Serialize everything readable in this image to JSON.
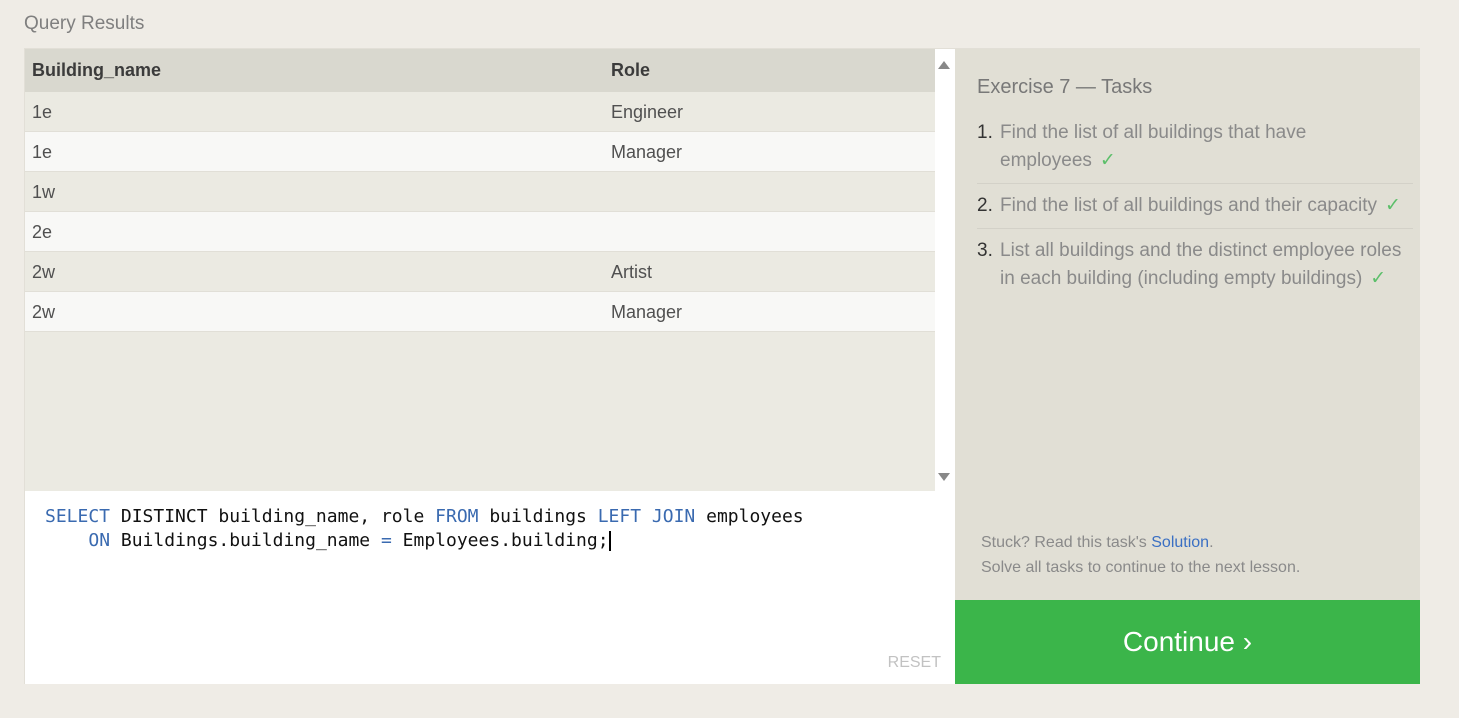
{
  "header": {
    "title": "Query Results"
  },
  "table": {
    "columns": [
      "Building_name",
      "Role"
    ],
    "rows": [
      [
        "1e",
        "Engineer"
      ],
      [
        "1e",
        "Manager"
      ],
      [
        "1w",
        ""
      ],
      [
        "2e",
        ""
      ],
      [
        "2w",
        "Artist"
      ],
      [
        "2w",
        "Manager"
      ]
    ]
  },
  "editor": {
    "line1": {
      "kw1": "SELECT",
      "t1": " DISTINCT building_name, role ",
      "kw2": "FROM",
      "t2": " buildings ",
      "kw3": "LEFT JOIN",
      "t3": " employees"
    },
    "line2": {
      "indent": "    ",
      "kw1": "ON",
      "t1": " Buildings.building_name ",
      "kw2": "=",
      "t2": " Employees.building;"
    },
    "reset_label": "RESET"
  },
  "exercise": {
    "title": "Exercise 7 — Tasks",
    "tasks": [
      {
        "num": "1.",
        "text": "Find the list of all buildings that have employees",
        "check": "✓"
      },
      {
        "num": "2.",
        "text": "Find the list of all buildings and their capacity",
        "check": "✓"
      },
      {
        "num": "3.",
        "text": "List all buildings and the distinct employee roles in each building (including empty buildings)",
        "check": "✓"
      }
    ],
    "stuck_prefix": "Stuck? Read this task's ",
    "solution_link": "Solution",
    "stuck_suffix": ".",
    "continue_hint": "Solve all tasks to continue to the next lesson."
  },
  "continue_button": {
    "label": "Continue ›"
  },
  "colors": {
    "accent_green": "#3bb54a",
    "link_blue": "#3a6fc3",
    "keyword_blue": "#3a6ab0"
  }
}
